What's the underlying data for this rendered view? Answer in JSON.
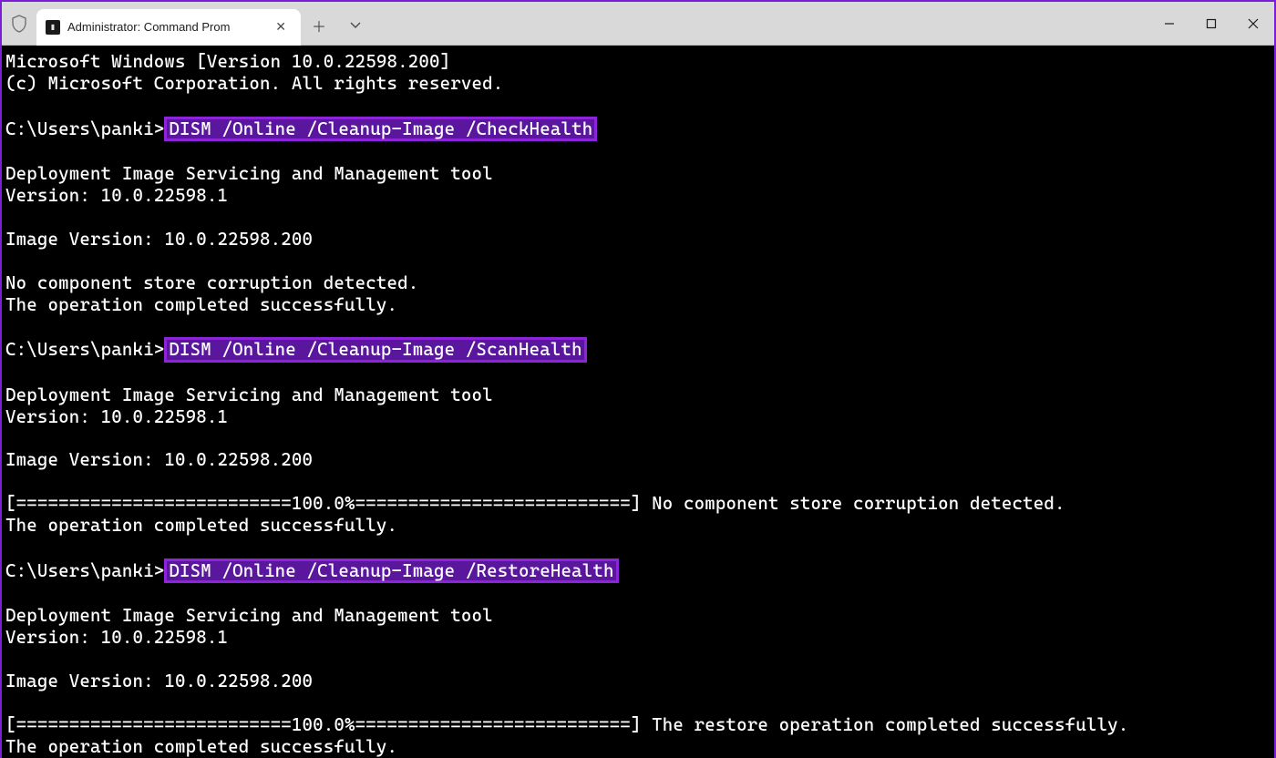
{
  "window": {
    "tab_title": "Administrator: Command Prom",
    "accent_color": "#8e24d9"
  },
  "terminal": {
    "header_version": "Microsoft Windows [Version 10.0.22598.200]",
    "header_copyright": "(c) Microsoft Corporation. All rights reserved.",
    "prompt_path": "C:\\Users\\panki>",
    "cmd_checkhealth": "DISM /Online /Cleanup-Image /CheckHealth",
    "cmd_scanhealth": "DISM /Online /Cleanup-Image /ScanHealth",
    "cmd_restorehealth": "DISM /Online /Cleanup-Image /RestoreHealth",
    "dism_header": "Deployment Image Servicing and Management tool",
    "dism_version": "Version: 10.0.22598.1",
    "image_version": "Image Version: 10.0.22598.200",
    "no_corruption": "No component store corruption detected.",
    "op_completed": "The operation completed successfully.",
    "progress_no_corruption": "[==========================100.0%==========================] No component store corruption detected.",
    "progress_restore": "[==========================100.0%==========================] The restore operation completed successfully."
  }
}
